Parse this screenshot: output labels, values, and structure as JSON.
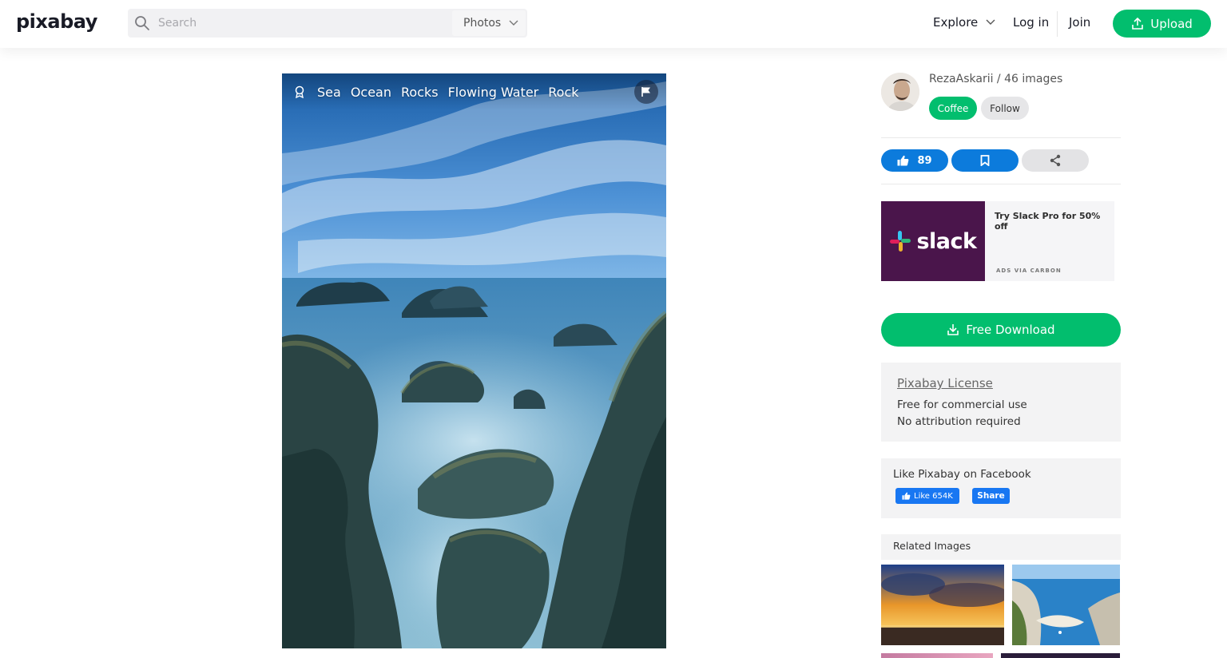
{
  "header": {
    "logo": "pixabay",
    "search_placeholder": "Search",
    "search_type": "Photos",
    "nav_explore": "Explore",
    "nav_login": "Log in",
    "nav_join": "Join",
    "upload_label": "Upload",
    "accent": "#02be6e"
  },
  "photo": {
    "tags": [
      "Sea",
      "Ocean",
      "Rocks",
      "Flowing Water",
      "Rock"
    ]
  },
  "author": {
    "line": "RezaAskarii / 46 images",
    "coffee_label": "Coffee",
    "follow_label": "Follow"
  },
  "actions": {
    "like_count": "89"
  },
  "ad": {
    "brand": "slack",
    "text": "Try Slack Pro for 50% off",
    "via": "ADS VIA CARBON"
  },
  "download": {
    "label": "Free Download"
  },
  "license": {
    "link": "Pixabay License",
    "line1": "Free for commercial use",
    "line2": "No attribution required"
  },
  "facebook": {
    "title": "Like Pixabay on Facebook",
    "like": "Like 654K",
    "share": "Share",
    "color": "#1877f2"
  },
  "related": {
    "heading": "Related Images"
  }
}
